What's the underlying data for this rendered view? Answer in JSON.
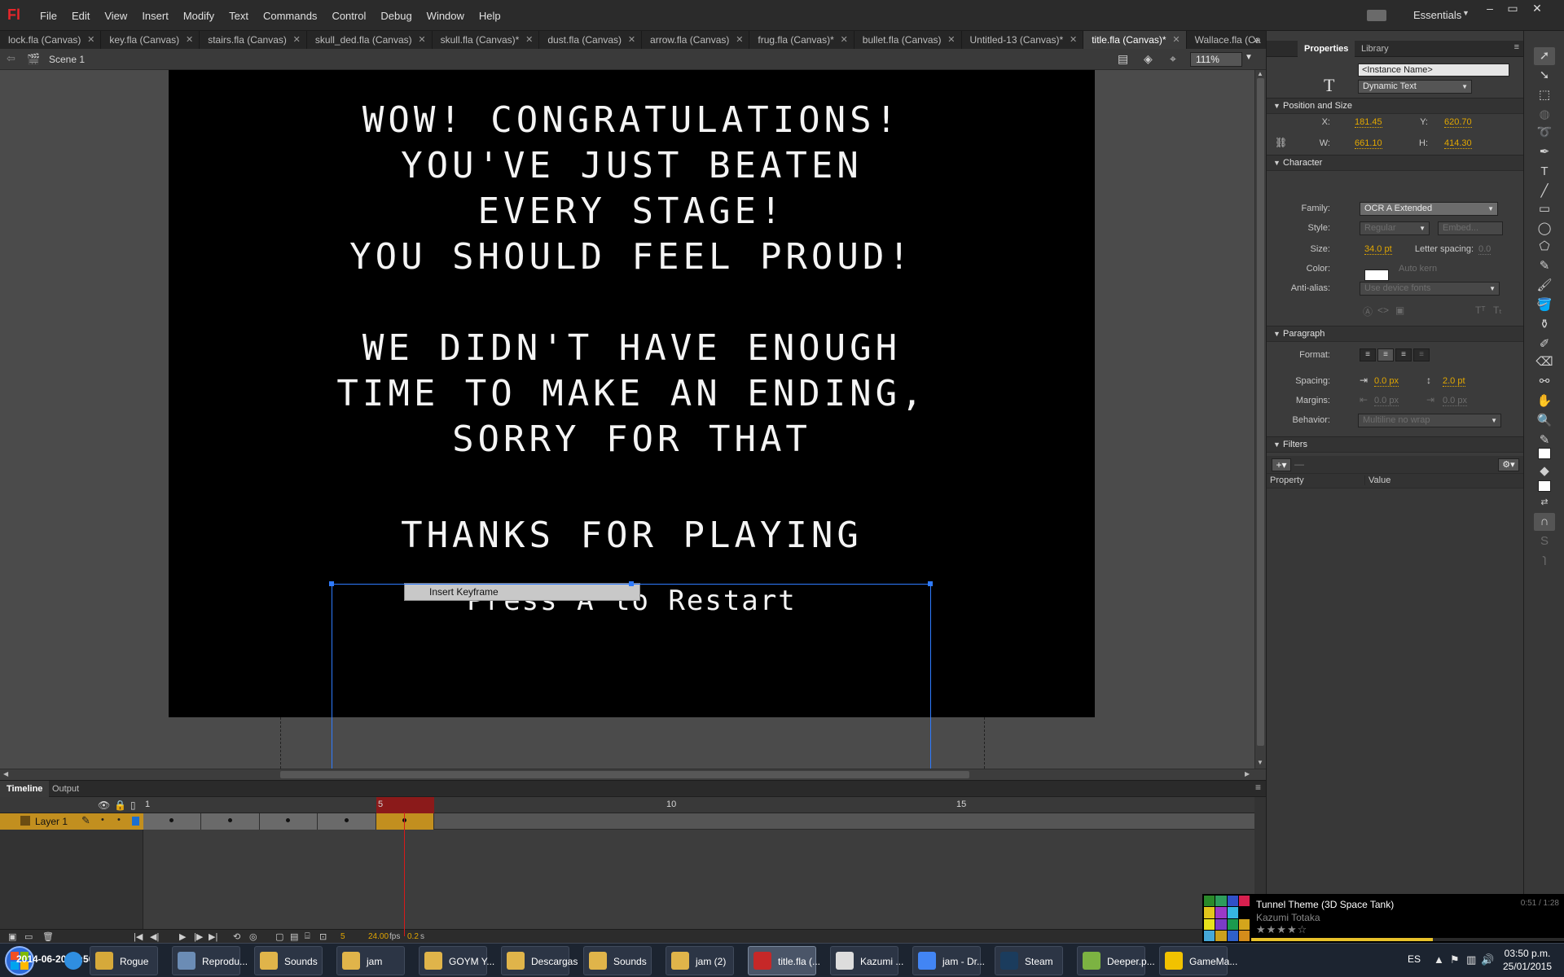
{
  "app": {
    "logo": "Fl",
    "menu": [
      "File",
      "Edit",
      "View",
      "Insert",
      "Modify",
      "Text",
      "Commands",
      "Control",
      "Debug",
      "Window",
      "Help"
    ],
    "workspace": "Essentials",
    "window_controls": [
      "–",
      "▭",
      "✕"
    ]
  },
  "doc_tabs": [
    {
      "label": "lock.fla (Canvas)",
      "active": false
    },
    {
      "label": "key.fla (Canvas)",
      "active": false
    },
    {
      "label": "stairs.fla (Canvas)",
      "active": false
    },
    {
      "label": "skull_ded.fla (Canvas)",
      "active": false
    },
    {
      "label": "skull.fla (Canvas)*",
      "active": false
    },
    {
      "label": "dust.fla (Canvas)",
      "active": false
    },
    {
      "label": "arrow.fla (Canvas)",
      "active": false
    },
    {
      "label": "frug.fla (Canvas)*",
      "active": false
    },
    {
      "label": "bullet.fla (Canvas)",
      "active": false
    },
    {
      "label": "Untitled-13 (Canvas)*",
      "active": false
    },
    {
      "label": "title.fla (Canvas)*",
      "active": true
    },
    {
      "label": "Wallace.fla (Ca",
      "active": false
    }
  ],
  "edit_bar": {
    "scene": "Scene 1",
    "zoom": "111%"
  },
  "stage": {
    "lines": [
      "WOW! CONGRATULATIONS!",
      "YOU'VE JUST BEATEN",
      "EVERY STAGE!",
      "YOU SHOULD FEEL PROUD!",
      "WE DIDN'T HAVE ENOUGH",
      "TIME TO MAKE AN ENDING,",
      "SORRY FOR THAT",
      "THANKS FOR PLAYING"
    ],
    "press_text": "Press A to Restart",
    "tooltip": "Insert Keyframe"
  },
  "timeline": {
    "tabs": [
      "Timeline",
      "Output"
    ],
    "ruler": [
      "1",
      "5",
      "10",
      "15"
    ],
    "layer_name": "Layer 1",
    "current_frame": "5",
    "fps": "24.00",
    "fps_unit": "fps",
    "elapsed": "0.2",
    "elapsed_unit": "s"
  },
  "properties": {
    "tabs": [
      "Properties",
      "Library"
    ],
    "instance_name_placeholder": "<Instance Name>",
    "text_type": "Dynamic Text",
    "position_size": {
      "title": "Position and Size",
      "x_label": "X:",
      "x": "181.45",
      "y_label": "Y:",
      "y": "620.70",
      "w_label": "W:",
      "w": "661.10",
      "h_label": "H:",
      "h": "414.30"
    },
    "character": {
      "title": "Character",
      "family_label": "Family:",
      "family": "OCR A Extended",
      "style_label": "Style:",
      "style": "Regular",
      "embed": "Embed...",
      "size_label": "Size:",
      "size": "34.0 pt",
      "letter_spacing_label": "Letter spacing:",
      "letter_spacing": "0.0",
      "color_label": "Color:",
      "color": "#ffffff",
      "auto_kern": "Auto kern",
      "anti_alias_label": "Anti-alias:",
      "anti_alias": "Use device fonts"
    },
    "paragraph": {
      "title": "Paragraph",
      "format_label": "Format:",
      "spacing_label": "Spacing:",
      "indent": "0.0 px",
      "line_spacing": "2.0 pt",
      "margins_label": "Margins:",
      "margin_left": "0.0 px",
      "margin_right": "0.0 px",
      "behavior_label": "Behavior:",
      "behavior": "Multiline no wrap"
    },
    "filters": {
      "title": "Filters",
      "col_property": "Property",
      "col_value": "Value"
    }
  },
  "taskbar": {
    "clock_overlay": "2014-06-20 14:50:36.0",
    "apps": [
      {
        "label": "Rogue",
        "color": "#d6a93a"
      },
      {
        "label": "Reprodu...",
        "color": "#6b8cb5"
      },
      {
        "label": "Sounds",
        "color": "#e0b44a"
      },
      {
        "label": "jam",
        "color": "#e0b44a"
      },
      {
        "label": "GOYM Y...",
        "color": "#e0b44a"
      },
      {
        "label": "Descargas",
        "color": "#e0b44a"
      },
      {
        "label": "Sounds",
        "color": "#e0b44a"
      },
      {
        "label": "jam (2)",
        "color": "#e0b44a"
      },
      {
        "label": "title.fla (...",
        "color": "#c62828"
      },
      {
        "label": "Kazumi ...",
        "color": "#dddddd"
      },
      {
        "label": "jam - Dr...",
        "color": "#4285f4"
      },
      {
        "label": "Steam",
        "color": "#1b3c5d"
      },
      {
        "label": "Deeper.p...",
        "color": "#7cb342"
      },
      {
        "label": "GameMa...",
        "color": "#f2c200"
      }
    ],
    "lang": "ES",
    "time": "03:50 p.m.",
    "date": "25/01/2015"
  },
  "music": {
    "title": "Tunnel Theme (3D Space Tank)",
    "artist": "Kazumi Totaka",
    "time": "0:51 / 1:28",
    "rating": 4,
    "progress": 0.58,
    "colors": [
      "#2a8a2a",
      "#2d9d5c",
      "#3050c8",
      "#d8204f",
      "#e3c61c",
      "#9b39c7",
      "#36b5e0",
      "#000000",
      "#e8e21c",
      "#7a3cc7",
      "#1b9a4e",
      "#d3a51c",
      "#45a8d8",
      "#caa01c",
      "#2f60c9",
      "#d48c1b"
    ]
  }
}
